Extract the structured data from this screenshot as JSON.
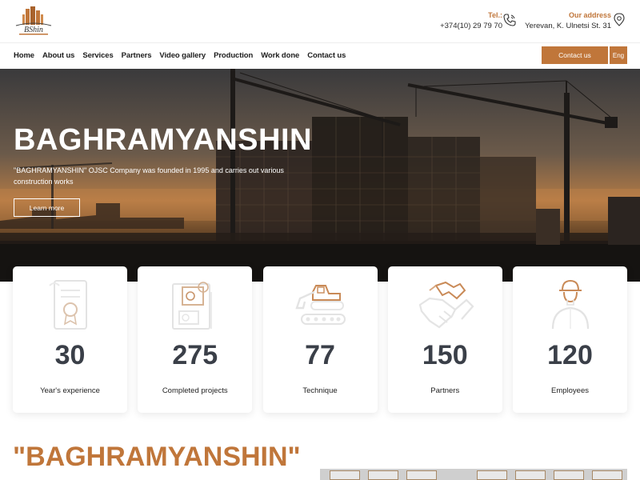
{
  "header": {
    "logo_text": "BShin",
    "tel_label": "Tel.:",
    "tel_value": "+374(10) 29 79 70",
    "address_label": "Our address",
    "address_value": "Yerevan, K. Ulnetsi St. 31"
  },
  "nav": {
    "items": [
      "Home",
      "About us",
      "Services",
      "Partners",
      "Video gallery",
      "Production",
      "Work done",
      "Contact us"
    ],
    "contact_button": "Contact us",
    "lang_button": "Eng"
  },
  "hero": {
    "title": "BAGHRAMYANSHIN",
    "subtitle": "\"BAGHRAMYANSHIN\" OJSC Company was founded in 1995 and carries out various construction works",
    "button": "Learn more"
  },
  "stats": [
    {
      "value": "30",
      "label": "Year's experience",
      "icon": "certificate-icon"
    },
    {
      "value": "275",
      "label": "Completed projects",
      "icon": "blueprint-icon"
    },
    {
      "value": "77",
      "label": "Technique",
      "icon": "excavator-icon"
    },
    {
      "value": "150",
      "label": "Partners",
      "icon": "handshake-icon"
    },
    {
      "value": "120",
      "label": "Employees",
      "icon": "worker-icon"
    }
  ],
  "section": {
    "title": "\"BAGHRAMYANSHIN\""
  },
  "colors": {
    "accent": "#c0763a",
    "stat_number": "#3a3f48"
  }
}
